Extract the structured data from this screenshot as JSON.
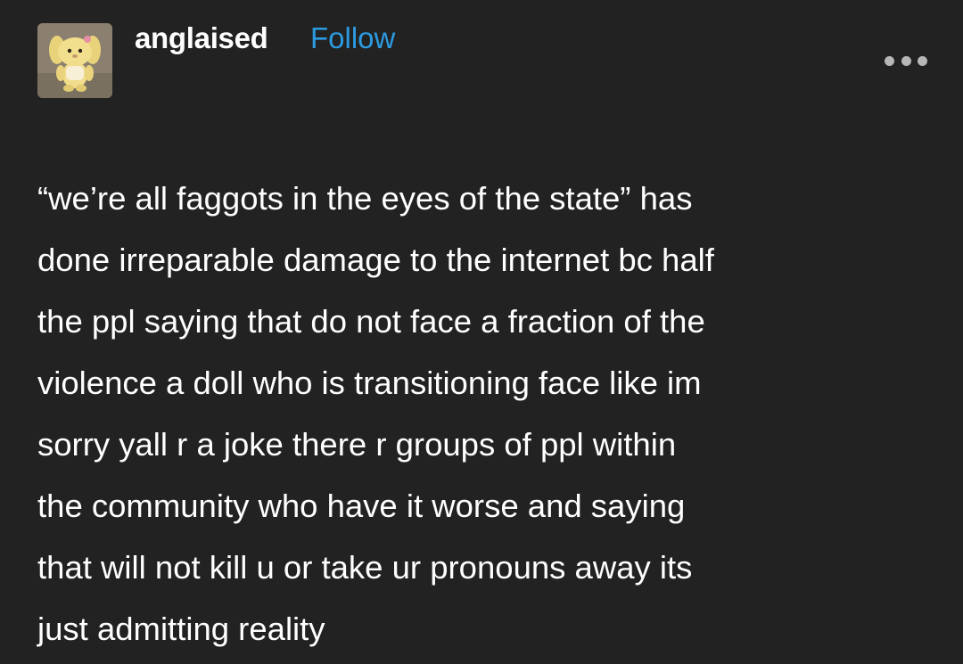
{
  "post": {
    "author": {
      "username": "anglaised",
      "avatar_icon": "plush-doll-avatar"
    },
    "follow_label": "Follow",
    "more_icon": "more-options-icon",
    "body_lines": [
      "“we’re all faggots in the eyes of the state” has",
      "done irreparable damage to the internet bc half",
      "the ppl saying that do not face a fraction of the",
      "violence a doll who is transitioning face like im",
      "sorry yall r a joke there r groups of ppl within",
      "the community who have it worse and saying",
      "that will not kill u or take ur pronouns away its",
      "just admitting reality"
    ]
  },
  "colors": {
    "background": "#222222",
    "text": "#ffffff",
    "follow": "#2c9ae0",
    "more_dots": "#b7b7b7"
  }
}
